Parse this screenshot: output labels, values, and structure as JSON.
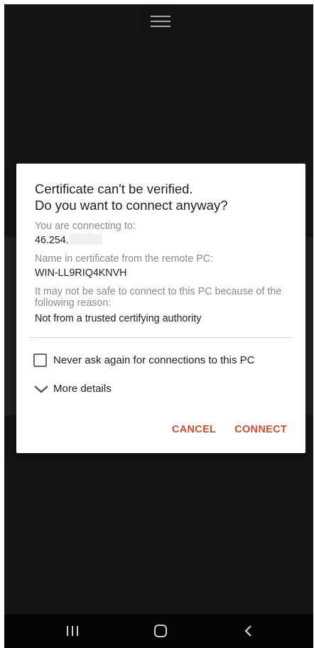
{
  "top_bar": {
    "menu_icon": "hamburger-menu-icon"
  },
  "dialog": {
    "title_line1": "Certificate can't be verified.",
    "title_line2": "Do you want to connect anyway?",
    "connecting_label": "You are connecting to:",
    "connecting_value": "46.254.",
    "cert_name_label": "Name in certificate from the remote PC:",
    "cert_name_value": "WIN-LL9RIQ4KNVH",
    "reason_label": "It may not be safe to connect to this PC because of the following reason:",
    "reason_value": "Not from a trusted certifying authority",
    "checkbox_label": "Never ask again for connections to this PC",
    "checkbox_checked": false,
    "details_label": "More details",
    "cancel_label": "CANCEL",
    "connect_label": "CONNECT",
    "accent_color": "#d84a2b"
  },
  "nav_bar": {
    "recent_icon": "recent-apps-icon",
    "home_icon": "home-icon",
    "back_icon": "back-icon"
  }
}
